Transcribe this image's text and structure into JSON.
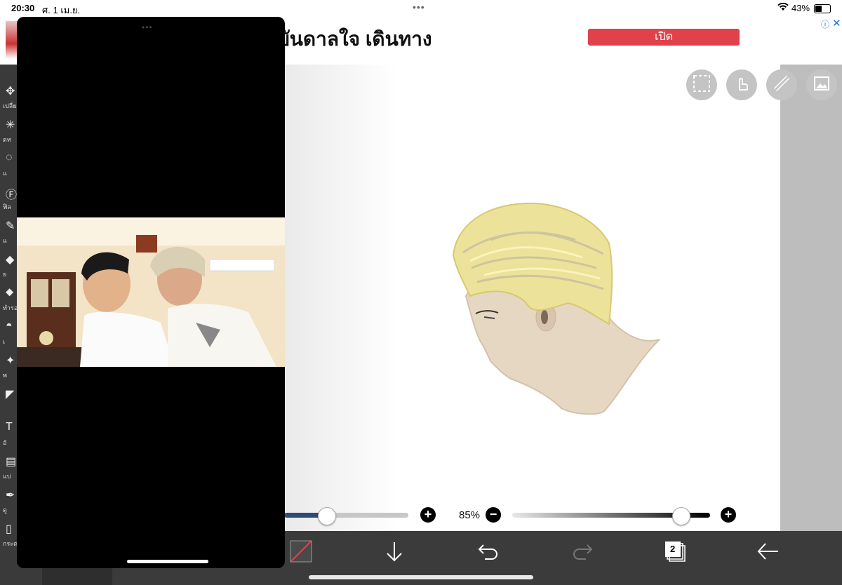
{
  "status_bar": {
    "time": "20:30",
    "date": "ศ. 1 เม.ย.",
    "battery": "43%",
    "battery_level": 0.43
  },
  "ad": {
    "headline": "บันดาลใจ เดินทาง",
    "open_button": "เปิด"
  },
  "sidebar": {
    "tools": [
      {
        "icon": "move-icon",
        "label": "เปลี่ย"
      },
      {
        "icon": "magic-wand-icon",
        "label": "ดท"
      },
      {
        "icon": "lasso-icon",
        "label": "แ"
      },
      {
        "icon": "filter-icon",
        "label": "ฟิล"
      },
      {
        "icon": "brush-icon",
        "label": "แ"
      },
      {
        "icon": "eraser-icon",
        "label": "ย"
      },
      {
        "icon": "blur-icon",
        "label": "ทำรอ"
      },
      {
        "icon": "bucket-icon",
        "label": "เ"
      },
      {
        "icon": "sparkle-icon",
        "label": "พ"
      },
      {
        "icon": "fill-icon",
        "label": ""
      },
      {
        "icon": "text-icon",
        "label": "อั"
      },
      {
        "icon": "frame-icon",
        "label": "แบ่"
      },
      {
        "icon": "eyedropper-icon",
        "label": "ดู"
      },
      {
        "icon": "canvas-icon",
        "label": "กระด"
      }
    ]
  },
  "canvas_tools": [
    "selection-icon",
    "touch-icon",
    "ruler-icon",
    "image-icon"
  ],
  "brush_controls": {
    "size_level": 0.34,
    "opacity_label": "85%",
    "opacity_level": 0.85
  },
  "bottom_toolbar": {
    "layers_count": "2"
  },
  "colors": {
    "accent_red": "#e0414a",
    "toolbar_bg": "#3b3b3b",
    "link_blue": "#1a73e8"
  }
}
